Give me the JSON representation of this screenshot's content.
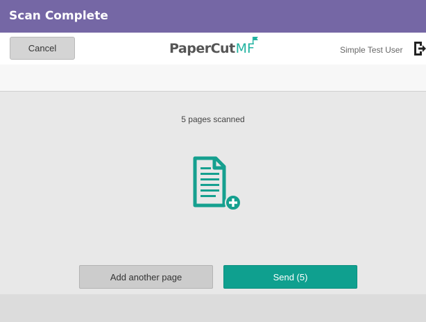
{
  "window": {
    "title": "Scan Complete"
  },
  "header": {
    "cancel_label": "Cancel",
    "logo_text_main": "PaperCut",
    "logo_text_accent": "MF",
    "user_name": "Simple Test User"
  },
  "main": {
    "status_text": "5 pages scanned",
    "icon": "document-add-icon",
    "add_page_label": "Add another page",
    "send_label": "Send (5)"
  },
  "colors": {
    "title_bar": "#7567a5",
    "accent": "#0fa08f",
    "secondary_button": "#cccccc"
  }
}
